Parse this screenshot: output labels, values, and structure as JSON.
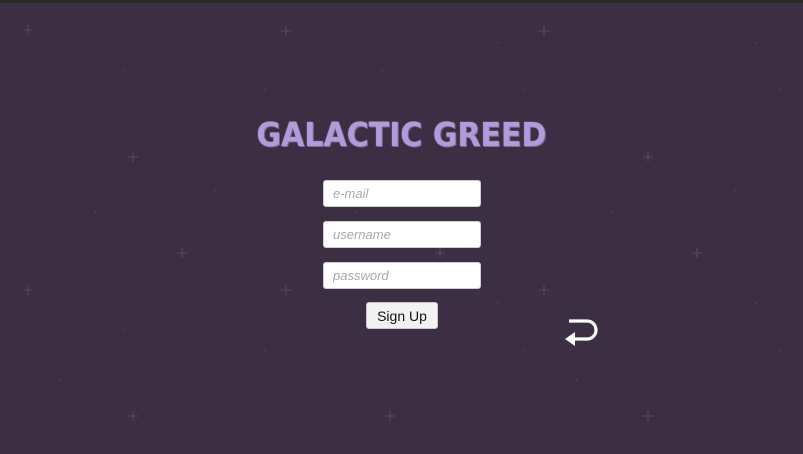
{
  "title": "GALACTIC GREED",
  "form": {
    "email_placeholder": "e-mail",
    "username_placeholder": "username",
    "password_placeholder": "password",
    "submit_label": "Sign Up"
  },
  "icons": {
    "back": "return-arrow-icon"
  },
  "colors": {
    "background": "#3d2f43",
    "title": "#b39ad9",
    "star": "#5a4b61"
  }
}
